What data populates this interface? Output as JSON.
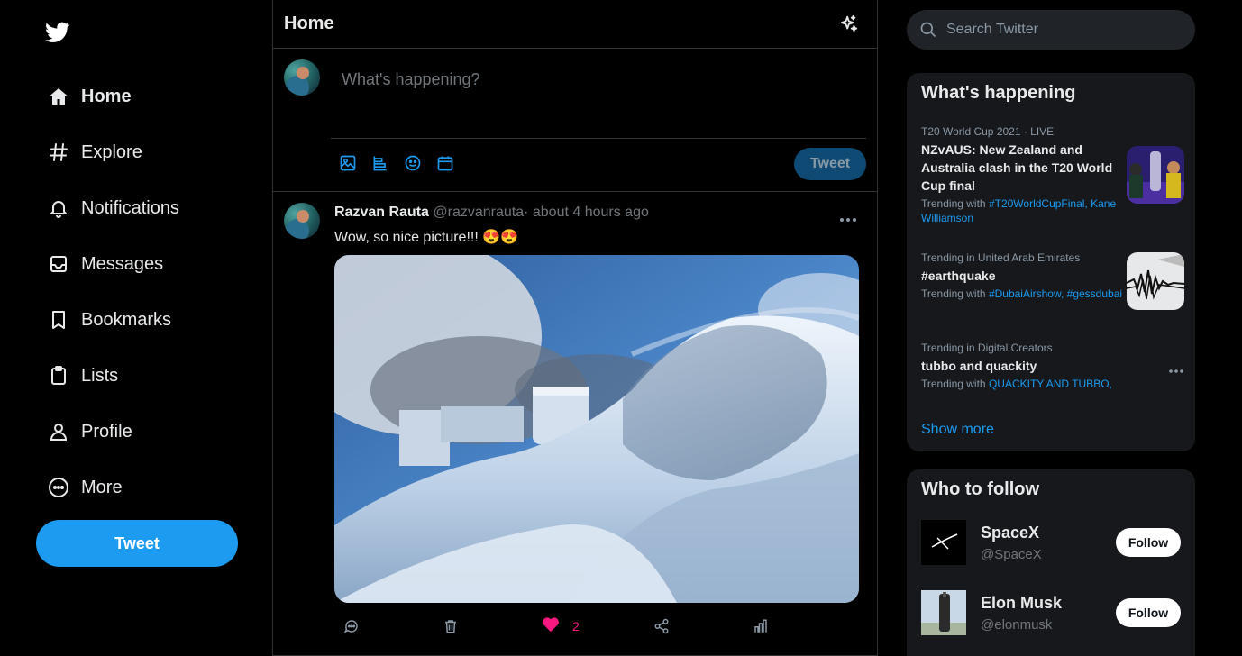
{
  "nav": {
    "items": [
      {
        "label": "Home",
        "icon": "home-icon"
      },
      {
        "label": "Explore",
        "icon": "hashtag-icon"
      },
      {
        "label": "Notifications",
        "icon": "bell-icon"
      },
      {
        "label": "Messages",
        "icon": "envelope-icon"
      },
      {
        "label": "Bookmarks",
        "icon": "bookmark-icon"
      },
      {
        "label": "Lists",
        "icon": "list-icon"
      },
      {
        "label": "Profile",
        "icon": "user-icon"
      },
      {
        "label": "More",
        "icon": "more-circle-icon"
      }
    ],
    "tweet_label": "Tweet"
  },
  "header": {
    "title": "Home"
  },
  "composer": {
    "placeholder": "What's happening?",
    "tweet_label": "Tweet"
  },
  "post": {
    "name": "Razvan Rauta",
    "meta": "@razvanrauta· about 4 hours ago",
    "text": "Wow, so nice picture!!! 😍😍",
    "likes": "2"
  },
  "search": {
    "placeholder": "Search Twitter"
  },
  "happening": {
    "title": "What's happening",
    "trends": [
      {
        "context": "T20 World Cup 2021 · LIVE",
        "title": "NZvAUS: New Zealand and Australia clash in the T20 World Cup final",
        "with_prefix": "Trending with ",
        "with_tags": "#T20WorldCupFinal, Kane Williamson"
      },
      {
        "context": "Trending in United Arab Emirates",
        "title": "#earthquake",
        "with_prefix": "Trending with ",
        "with_tags": "#DubaiAirshow, #gessdubai"
      },
      {
        "context": "Trending in Digital Creators",
        "title": "tubbo and quackity",
        "with_prefix": "Trending with ",
        "with_tags": "QUACKITY AND TUBBO,"
      }
    ],
    "show_more": "Show more"
  },
  "who_to_follow": {
    "title": "Who to follow",
    "accounts": [
      {
        "name": "SpaceX",
        "handle": "@SpaceX",
        "button": "Follow"
      },
      {
        "name": "Elon Musk",
        "handle": "@elonmusk",
        "button": "Follow"
      }
    ]
  },
  "colors": {
    "accent": "#1d9bf0",
    "like": "#f91880",
    "background": "#000000",
    "panel": "#16181c"
  }
}
